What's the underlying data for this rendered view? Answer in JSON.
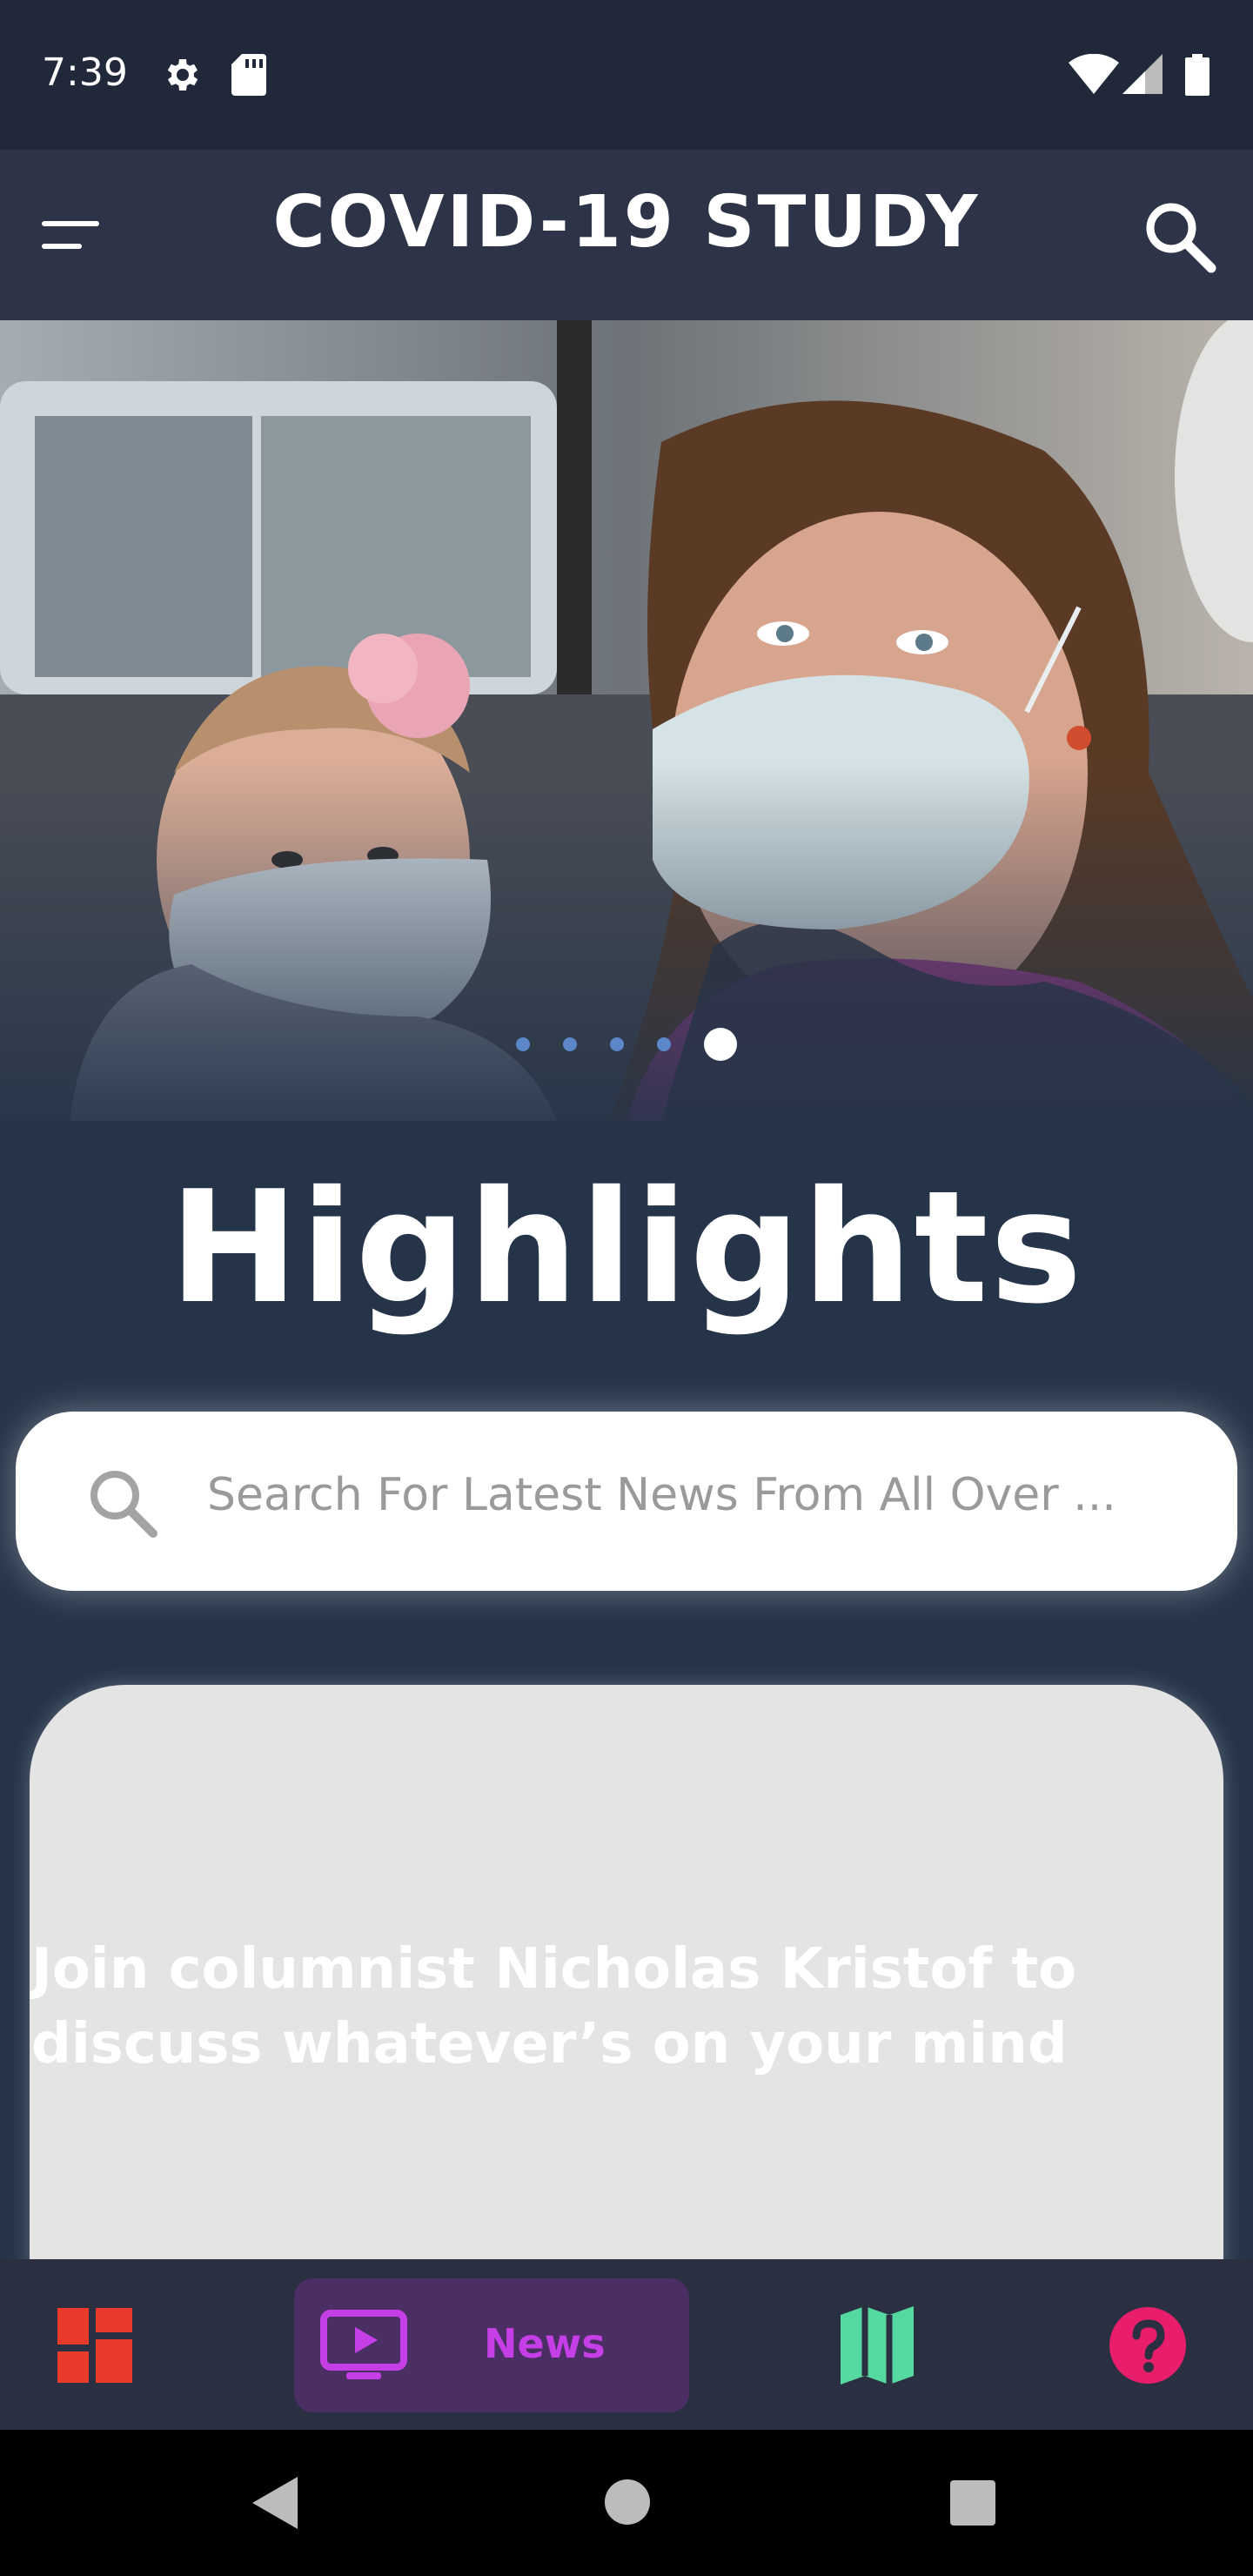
{
  "status_bar": {
    "time": "7:39"
  },
  "app_bar": {
    "title": "COVID-19 STUDY"
  },
  "carousel": {
    "slide_count": 5,
    "active_index": 4
  },
  "highlights": {
    "heading": "Highlights"
  },
  "search": {
    "placeholder": "Search For Latest News From All Over ..."
  },
  "news_card": {
    "headline": "Join columnist Nicholas Kristof to discuss whatever’s on your mind"
  },
  "bottom_nav": {
    "news_label": "News"
  },
  "colors": {
    "background": "#253449",
    "app_bar": "#2d3447",
    "news_active_bg": "#4b2e64",
    "news_accent": "#c53ee6",
    "dashboard_red": "#ea3a2c",
    "map_green": "#55d9a0",
    "help_pink": "#e81d6c"
  }
}
